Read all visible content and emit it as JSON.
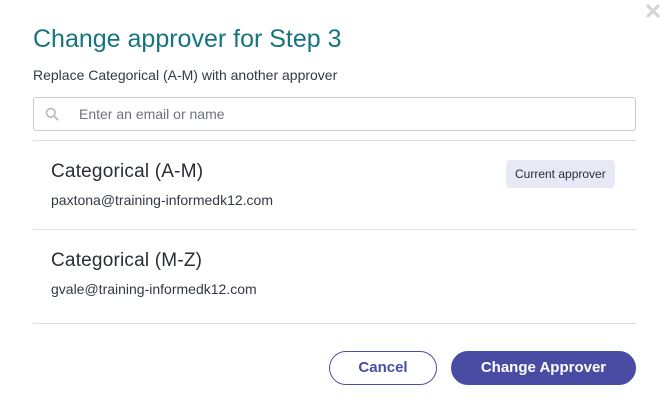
{
  "dialog": {
    "title": "Change approver for Step 3",
    "subtitle": "Replace Categorical (A-M) with another approver"
  },
  "search": {
    "placeholder": "Enter an email or name",
    "value": "",
    "icon": "search-icon"
  },
  "approvers": [
    {
      "name": "Categorical (A-M)",
      "email": "paxtona@training-informedk12.com",
      "badge": "Current approver"
    },
    {
      "name": "Categorical (M-Z)",
      "email": "gvale@training-informedk12.com"
    }
  ],
  "actions": {
    "cancel_label": "Cancel",
    "confirm_label": "Change Approver"
  },
  "colors": {
    "title": "#17757f",
    "primary": "#4a4ca3",
    "badge_bg": "#e8e9f6"
  }
}
